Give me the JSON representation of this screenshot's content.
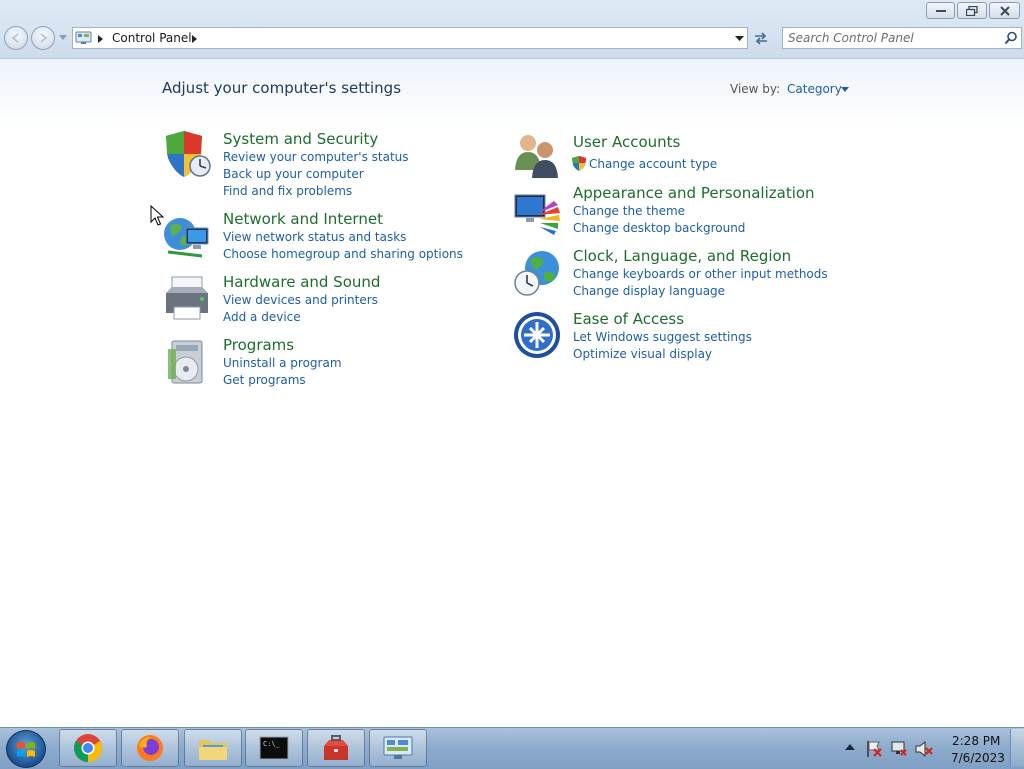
{
  "window": {
    "address_path": "Control Panel",
    "search_placeholder": "Search Control Panel"
  },
  "main": {
    "heading": "Adjust your computer's settings",
    "view_by_label": "View by:",
    "view_by_value": "Category"
  },
  "categories": [
    {
      "title": "System and Security",
      "icon": "shield-icon",
      "links": [
        "Review your computer's status",
        "Back up your computer",
        "Find and fix problems"
      ]
    },
    {
      "title": "Network and Internet",
      "icon": "network-globe-icon",
      "links": [
        "View network status and tasks",
        "Choose homegroup and sharing options"
      ]
    },
    {
      "title": "Hardware and Sound",
      "icon": "printer-icon",
      "links": [
        "View devices and printers",
        "Add a device"
      ]
    },
    {
      "title": "Programs",
      "icon": "programs-disc-icon",
      "links": [
        "Uninstall a program",
        "Get programs"
      ]
    },
    {
      "title": "User Accounts",
      "icon": "users-icon",
      "links": [
        "Change account type"
      ]
    },
    {
      "title": "Appearance and Personalization",
      "icon": "monitor-palette-icon",
      "links": [
        "Change the theme",
        "Change desktop background"
      ]
    },
    {
      "title": "Clock, Language, and Region",
      "icon": "globe-clock-icon",
      "links": [
        "Change keyboards or other input methods",
        "Change display language"
      ]
    },
    {
      "title": "Ease of Access",
      "icon": "ease-of-access-icon",
      "links": [
        "Let Windows suggest settings",
        "Optimize visual display"
      ]
    }
  ],
  "taskbar": {
    "items": [
      "chrome-icon",
      "firefox-icon",
      "file-explorer-icon",
      "terminal-icon",
      "toolbox-icon",
      "control-panel-icon"
    ],
    "clock_time": "2:28 PM",
    "clock_date": "7/6/2023"
  },
  "colors": {
    "category_title": "#1d6e2c",
    "link": "#1e5ea8",
    "heading": "#1e395b"
  }
}
